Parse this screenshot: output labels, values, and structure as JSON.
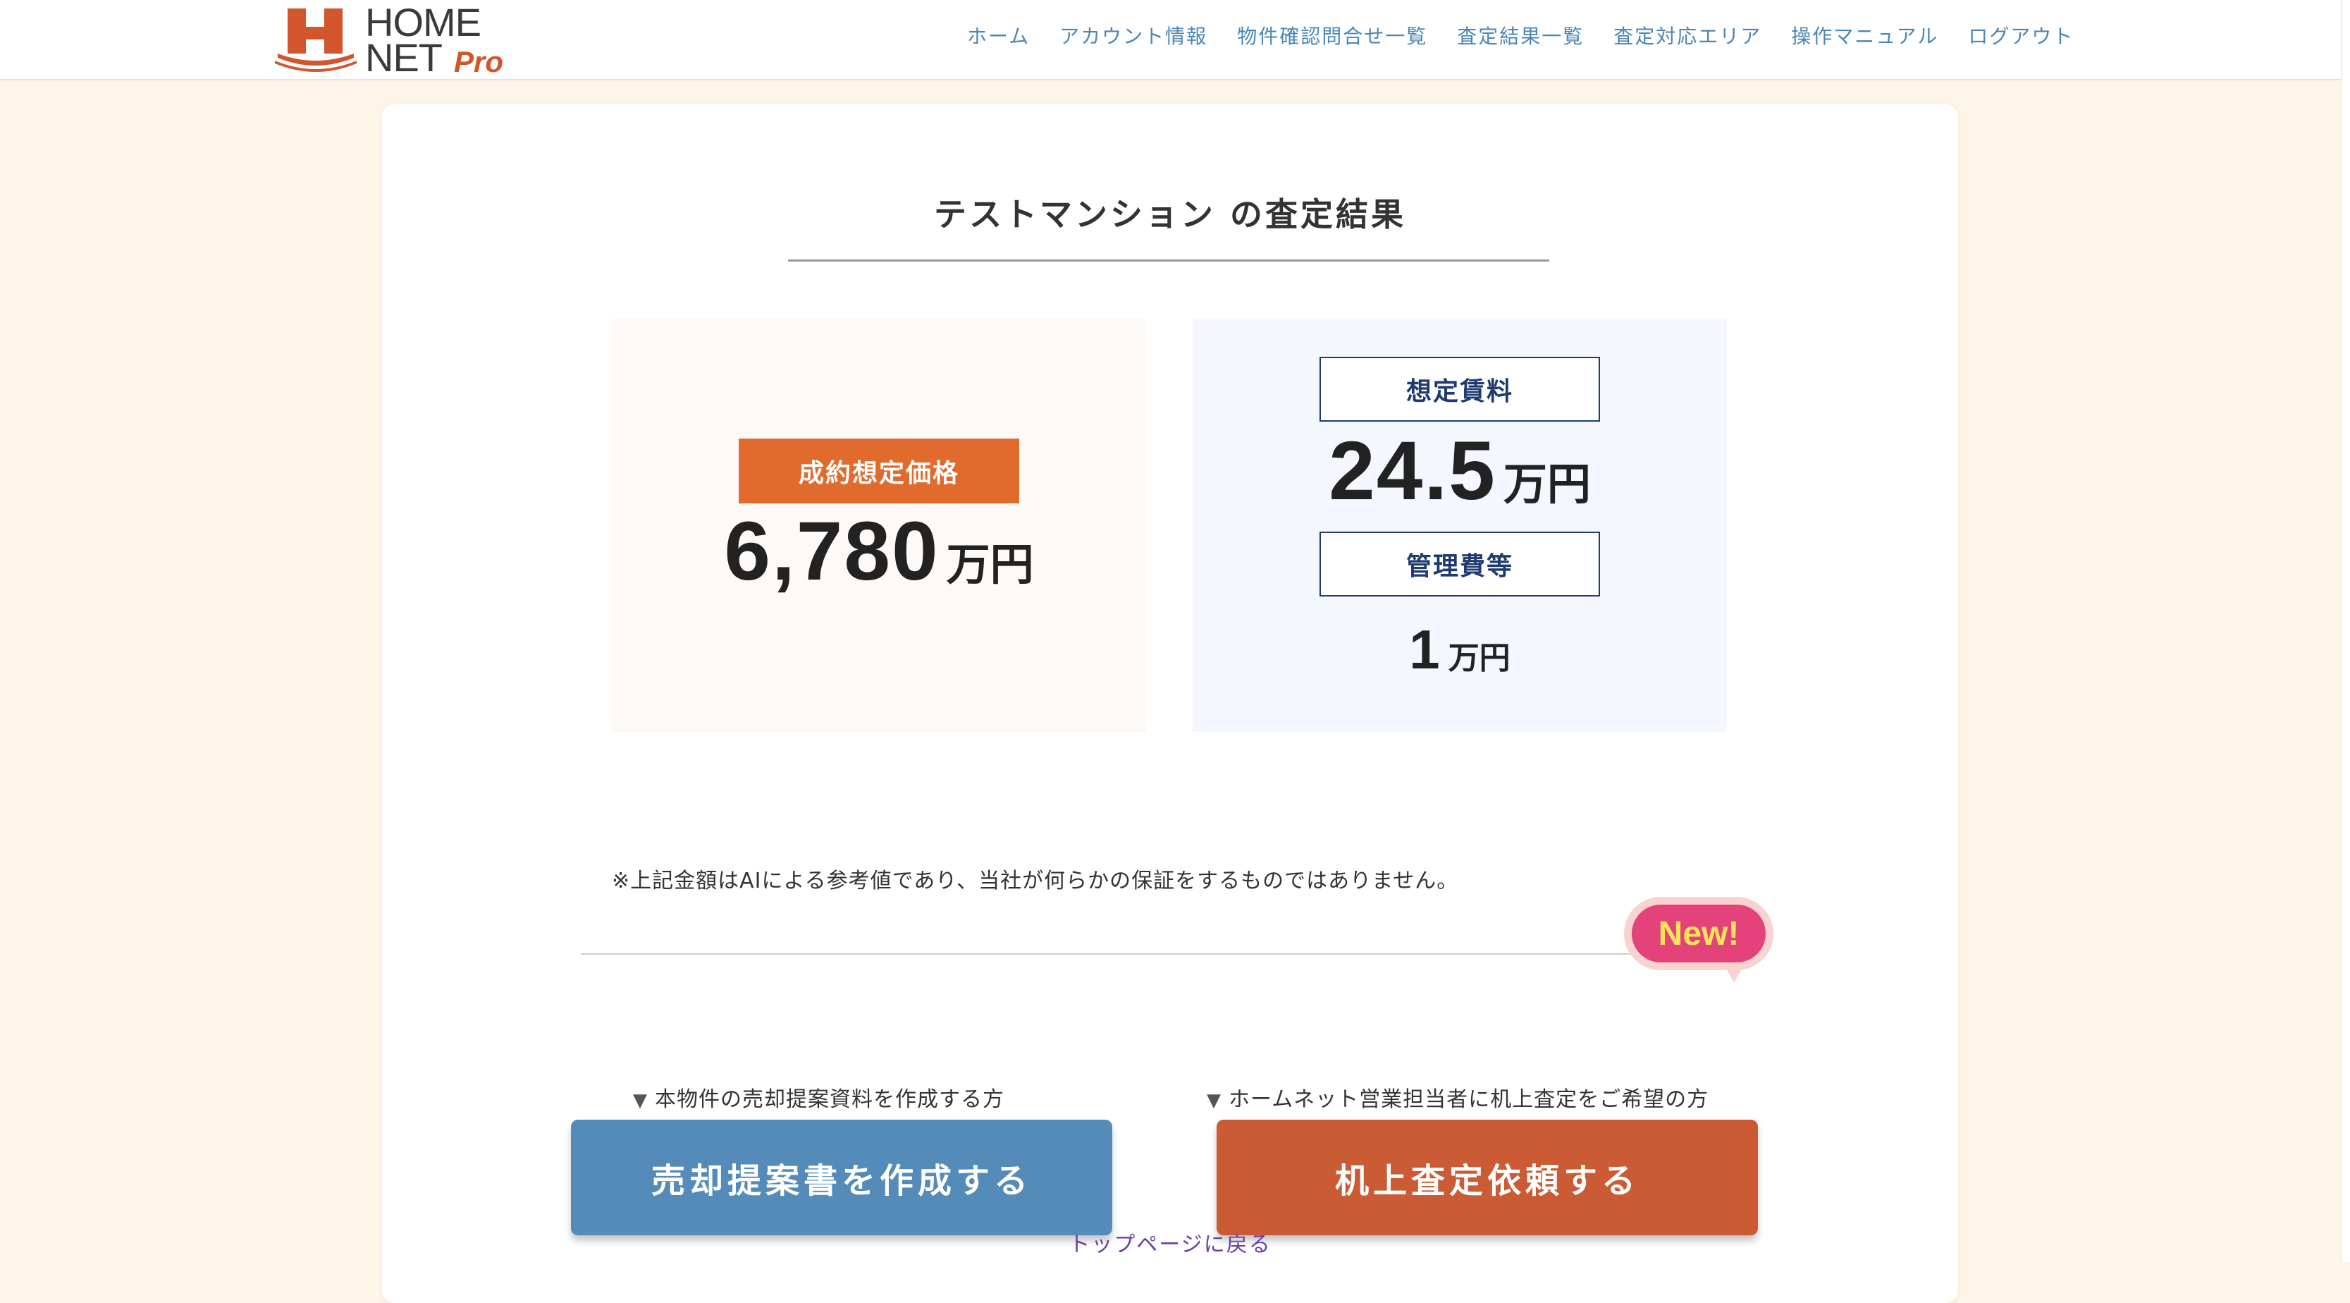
{
  "header": {
    "logo": {
      "home": "HOME",
      "net": "NET",
      "pro": "Pro"
    },
    "nav": [
      {
        "label": "ホーム"
      },
      {
        "label": "アカウント情報"
      },
      {
        "label": "物件確認問合せ一覧"
      },
      {
        "label": "査定結果一覧"
      },
      {
        "label": "査定対応エリア"
      },
      {
        "label": "操作マニュアル"
      },
      {
        "label": "ログアウト"
      }
    ]
  },
  "main": {
    "title": "テストマンション の査定結果",
    "sale": {
      "label": "成約想定価格",
      "value": "6,780",
      "unit": "万円"
    },
    "rent": {
      "label": "想定賃料",
      "value": "24.5",
      "unit": "万円"
    },
    "management": {
      "label": "管理費等",
      "value": "1",
      "unit": "万円"
    },
    "disclaimer": "※上記金額はAIによる参考値であり、当社が何らかの保証をするものではありません。"
  },
  "actions": {
    "proposal": {
      "caption": "本物件の売却提案資料を作成する方",
      "button": "売却提案書を作成する"
    },
    "desk": {
      "caption": "ホームネット営業担当者に机上査定をご希望の方",
      "button": "机上査定依頼する",
      "badge": "New!"
    },
    "triangle": "▼",
    "back_link": "トップページに戻る"
  },
  "colors": {
    "accent_orange": "#e06b2c",
    "button_blue": "#548bb9",
    "button_orange": "#cb5b34",
    "nav_blue": "#4a86b5",
    "new_badge_pink": "#e4427a"
  }
}
